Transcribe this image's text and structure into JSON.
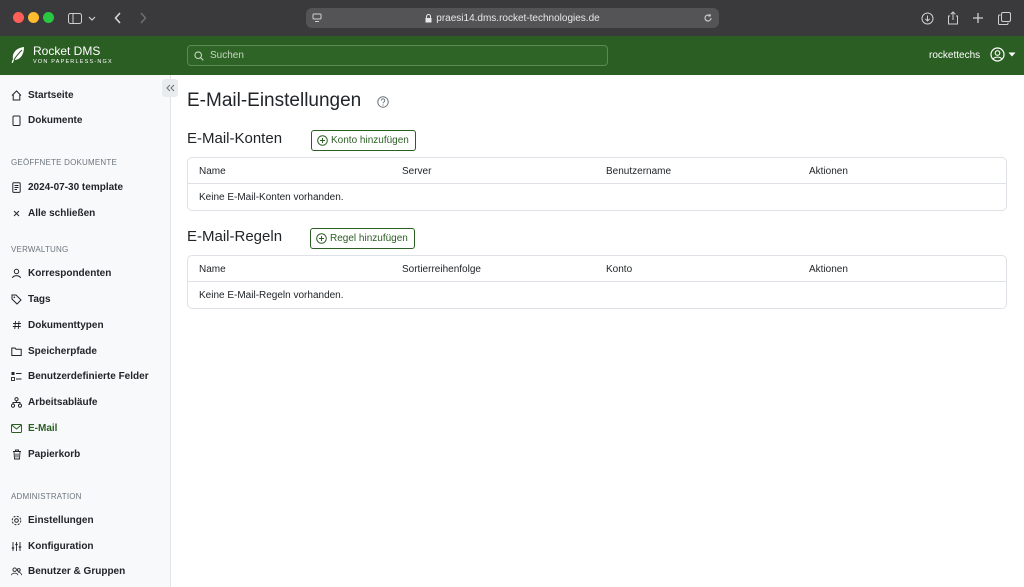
{
  "browser": {
    "url": "praesi14.dms.rocket-technologies.de"
  },
  "header": {
    "app_name": "Rocket DMS",
    "app_subtitle": "VON PAPERLESS-NGX",
    "search_placeholder": "Suchen",
    "username": "rockettechs"
  },
  "sidebar": {
    "main": [
      {
        "label": "Startseite",
        "icon": "house-icon"
      },
      {
        "label": "Dokumente",
        "icon": "document-icon"
      }
    ],
    "open_docs_title": "GEÖFFNETE DOKUMENTE",
    "open_docs": [
      {
        "label": "2024-07-30 template",
        "icon": "file-text-icon"
      },
      {
        "label": "Alle schließen",
        "icon": "close-icon"
      }
    ],
    "manage_title": "VERWALTUNG",
    "manage": [
      {
        "label": "Korrespondenten",
        "icon": "person-icon"
      },
      {
        "label": "Tags",
        "icon": "tag-icon"
      },
      {
        "label": "Dokumenttypen",
        "icon": "hash-icon"
      },
      {
        "label": "Speicherpfade",
        "icon": "folder-icon"
      },
      {
        "label": "Benutzerdefinierte Felder",
        "icon": "ui-checks-icon"
      },
      {
        "label": "Arbeitsabläufe",
        "icon": "workflow-icon"
      },
      {
        "label": "E-Mail",
        "icon": "envelope-icon"
      },
      {
        "label": "Papierkorb",
        "icon": "trash-icon"
      }
    ],
    "admin_title": "ADMINISTRATION",
    "admin": [
      {
        "label": "Einstellungen",
        "icon": "gear-icon"
      },
      {
        "label": "Konfiguration",
        "icon": "sliders-icon"
      },
      {
        "label": "Benutzer & Gruppen",
        "icon": "people-icon"
      }
    ]
  },
  "main": {
    "title": "E-Mail-Einstellungen",
    "accounts": {
      "heading": "E-Mail-Konten",
      "add_label": "Konto hinzufügen",
      "columns": [
        "Name",
        "Server",
        "Benutzername",
        "Aktionen"
      ],
      "empty": "Keine E-Mail-Konten vorhanden."
    },
    "rules": {
      "heading": "E-Mail-Regeln",
      "add_label": "Regel hinzufügen",
      "columns": [
        "Name",
        "Sortierreihenfolge",
        "Konto",
        "Aktionen"
      ],
      "empty": "Keine E-Mail-Regeln vorhanden."
    }
  },
  "colors": {
    "brand": "#2b5e23",
    "sidebar_bg": "#f8f9fa"
  }
}
